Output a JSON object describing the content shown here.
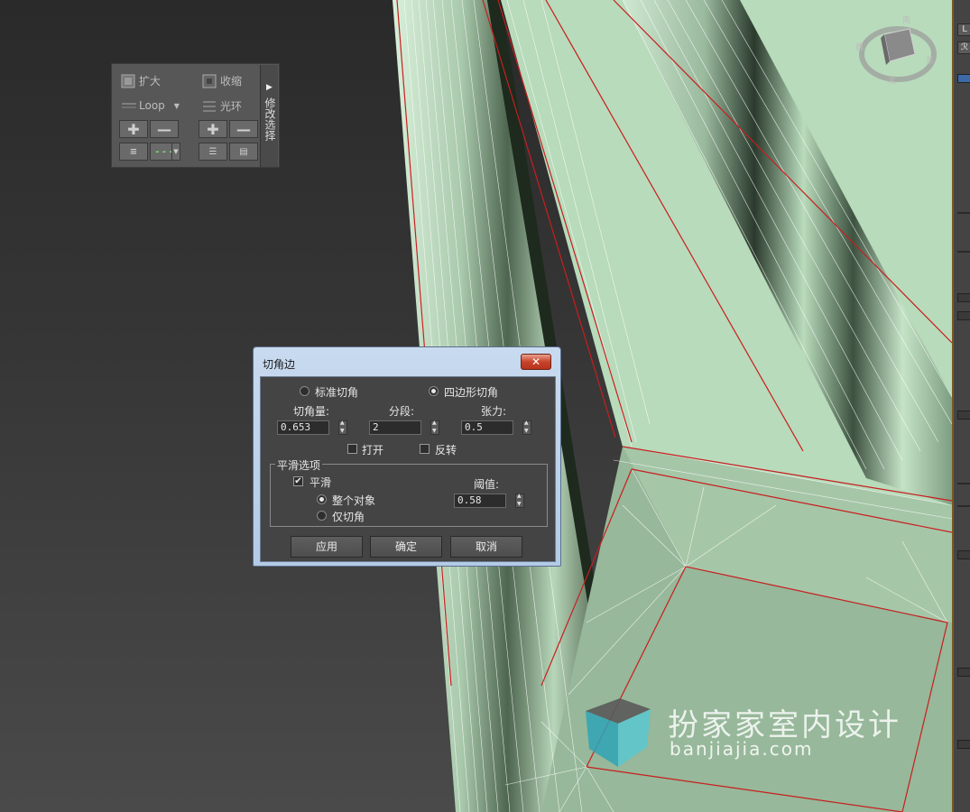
{
  "ribbon": {
    "grow_label": "扩大",
    "shrink_label": "收缩",
    "loop_label": "Loop",
    "ring_label": "光环",
    "tab_label": "修改选择"
  },
  "dialog": {
    "title": "切角边",
    "close_glyph": "✕",
    "mode_standard": "标准切角",
    "mode_quad": "四边形切角",
    "mode_selected": "四边形切角",
    "amount_label": "切角量:",
    "amount_value": "0.653",
    "segments_label": "分段:",
    "segments_value": "2",
    "tension_label": "张力:",
    "tension_value": "0.5",
    "open_label": "打开",
    "open_checked": false,
    "invert_label": "反转",
    "invert_checked": false,
    "smooth_group_label": "平滑选项",
    "smooth_label": "平滑",
    "smooth_checked": true,
    "threshold_label": "阈值:",
    "threshold_value": "0.58",
    "whole_object_label": "整个对象",
    "chamfer_only_label": "仅切角",
    "smooth_scope_selected": "整个对象",
    "apply_label": "应用",
    "ok_label": "确定",
    "cancel_label": "取消"
  },
  "watermark": {
    "brand": "扮家家室内设计",
    "url": "banjiajia.com"
  },
  "colors": {
    "mesh_face": "#b9dcbc",
    "mesh_face_dark": "#93b497",
    "wire_white": "#ffffff",
    "wire_red": "#d02020",
    "dialog_frame": "#c8daef",
    "close_button": "#c8432a"
  }
}
